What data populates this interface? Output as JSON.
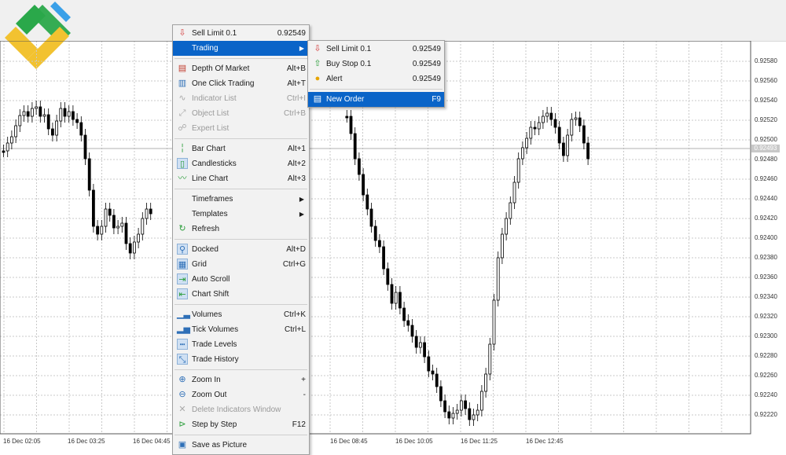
{
  "chart": {
    "price_levels": [
      "0.92580",
      "0.92560",
      "0.92540",
      "0.92520",
      "0.92500",
      "0.92480",
      "0.92460",
      "0.92440",
      "0.92420",
      "0.92400",
      "0.92380",
      "0.92360",
      "0.92340",
      "0.92320",
      "0.92300",
      "0.92280",
      "0.92260",
      "0.92240",
      "0.92220"
    ],
    "current_price_tag": "0.92493",
    "time_labels": [
      "16 Dec 02:05",
      "16 Dec 03:25",
      "16 Dec 04:45",
      "16 Dec 08:45",
      "16 Dec 10:05",
      "16 Dec 11:25",
      "16 Dec 12:45"
    ]
  },
  "context_menu": {
    "items": [
      {
        "icon": "sell-limit-icon",
        "glyph": "⇩",
        "color": "#d23b3b",
        "label": "Sell Limit 0.1",
        "shortcut": "0.92549",
        "state": "normal"
      },
      {
        "icon": "",
        "glyph": "",
        "color": "",
        "label": "Trading",
        "shortcut": "",
        "state": "highlight",
        "submenu": true
      },
      {
        "icon": "depth-of-market-icon",
        "glyph": "▤",
        "color": "#c0392b",
        "label": "Depth Of Market",
        "shortcut": "Alt+B",
        "state": "normal"
      },
      {
        "icon": "one-click-trading-icon",
        "glyph": "▥",
        "color": "#2e6fb7",
        "label": "One Click Trading",
        "shortcut": "Alt+T",
        "state": "normal"
      },
      {
        "icon": "indicator-list-icon",
        "glyph": "∿",
        "color": "#aaaaaa",
        "label": "Indicator List",
        "shortcut": "Ctrl+I",
        "state": "disabled"
      },
      {
        "icon": "object-list-icon",
        "glyph": "⤢",
        "color": "#aaaaaa",
        "label": "Object List",
        "shortcut": "Ctrl+B",
        "state": "disabled"
      },
      {
        "icon": "expert-list-icon",
        "glyph": "☍",
        "color": "#aaaaaa",
        "label": "Expert List",
        "shortcut": "",
        "state": "disabled"
      },
      {
        "icon": "bar-chart-icon",
        "glyph": "╎",
        "color": "#2a9d3a",
        "label": "Bar Chart",
        "shortcut": "Alt+1",
        "state": "normal"
      },
      {
        "icon": "candlesticks-icon",
        "glyph": "▯",
        "color": "#2a9d3a",
        "label": "Candlesticks",
        "shortcut": "Alt+2",
        "state": "normal",
        "boxed": true
      },
      {
        "icon": "line-chart-icon",
        "glyph": "〰",
        "color": "#2a9d3a",
        "label": "Line Chart",
        "shortcut": "Alt+3",
        "state": "normal"
      },
      {
        "icon": "",
        "glyph": "",
        "color": "",
        "label": "Timeframes",
        "shortcut": "",
        "state": "normal",
        "submenu": true
      },
      {
        "icon": "",
        "glyph": "",
        "color": "",
        "label": "Templates",
        "shortcut": "",
        "state": "normal",
        "submenu": true
      },
      {
        "icon": "refresh-icon",
        "glyph": "↻",
        "color": "#2a9d3a",
        "label": "Refresh",
        "shortcut": "",
        "state": "normal"
      },
      {
        "icon": "docked-icon",
        "glyph": "⚲",
        "color": "#2e6fb7",
        "label": "Docked",
        "shortcut": "Alt+D",
        "state": "normal",
        "boxed": true
      },
      {
        "icon": "grid-icon",
        "glyph": "▦",
        "color": "#2e6fb7",
        "label": "Grid",
        "shortcut": "Ctrl+G",
        "state": "normal",
        "boxed": true
      },
      {
        "icon": "auto-scroll-icon",
        "glyph": "⇥",
        "color": "#2a9d3a",
        "label": "Auto Scroll",
        "shortcut": "",
        "state": "normal",
        "boxed": true
      },
      {
        "icon": "chart-shift-icon",
        "glyph": "⇤",
        "color": "#2a9d3a",
        "label": "Chart Shift",
        "shortcut": "",
        "state": "normal",
        "boxed": true
      },
      {
        "icon": "volumes-icon",
        "glyph": "▁▃",
        "color": "#2e6fb7",
        "label": "Volumes",
        "shortcut": "Ctrl+K",
        "state": "normal"
      },
      {
        "icon": "tick-volumes-icon",
        "glyph": "▂▅",
        "color": "#2e6fb7",
        "label": "Tick Volumes",
        "shortcut": "Ctrl+L",
        "state": "normal"
      },
      {
        "icon": "trade-levels-icon",
        "glyph": "┅",
        "color": "#2e6fb7",
        "label": "Trade Levels",
        "shortcut": "",
        "state": "normal",
        "boxed": true
      },
      {
        "icon": "trade-history-icon",
        "glyph": "⤡",
        "color": "#2e6fb7",
        "label": "Trade History",
        "shortcut": "",
        "state": "normal",
        "boxed": true
      },
      {
        "icon": "zoom-in-icon",
        "glyph": "⊕",
        "color": "#2e6fb7",
        "label": "Zoom In",
        "shortcut": "+",
        "state": "normal"
      },
      {
        "icon": "zoom-out-icon",
        "glyph": "⊖",
        "color": "#2e6fb7",
        "label": "Zoom Out",
        "shortcut": "-",
        "state": "normal"
      },
      {
        "icon": "delete-indicators-icon",
        "glyph": "✕",
        "color": "#aaaaaa",
        "label": "Delete Indicators Window",
        "shortcut": "",
        "state": "disabled"
      },
      {
        "icon": "step-by-step-icon",
        "glyph": "⊳",
        "color": "#2a9d3a",
        "label": "Step by Step",
        "shortcut": "F12",
        "state": "normal"
      },
      {
        "icon": "save-as-picture-icon",
        "glyph": "▣",
        "color": "#2e6fb7",
        "label": "Save as Picture",
        "shortcut": "",
        "state": "normal"
      }
    ]
  },
  "trading_submenu": {
    "items": [
      {
        "icon": "sell-limit-icon",
        "glyph": "⇩",
        "color": "#d23b3b",
        "label": "Sell Limit 0.1",
        "shortcut": "0.92549",
        "state": "normal"
      },
      {
        "icon": "buy-stop-icon",
        "glyph": "⇧",
        "color": "#2a9d3a",
        "label": "Buy Stop 0.1",
        "shortcut": "0.92549",
        "state": "normal"
      },
      {
        "icon": "alert-icon",
        "glyph": "●",
        "color": "#e6a400",
        "label": "Alert",
        "shortcut": "0.92549",
        "state": "normal"
      },
      {
        "icon": "new-order-icon",
        "glyph": "▤",
        "color": "#ffffff",
        "label": "New Order",
        "shortcut": "F9",
        "state": "highlight"
      }
    ]
  }
}
